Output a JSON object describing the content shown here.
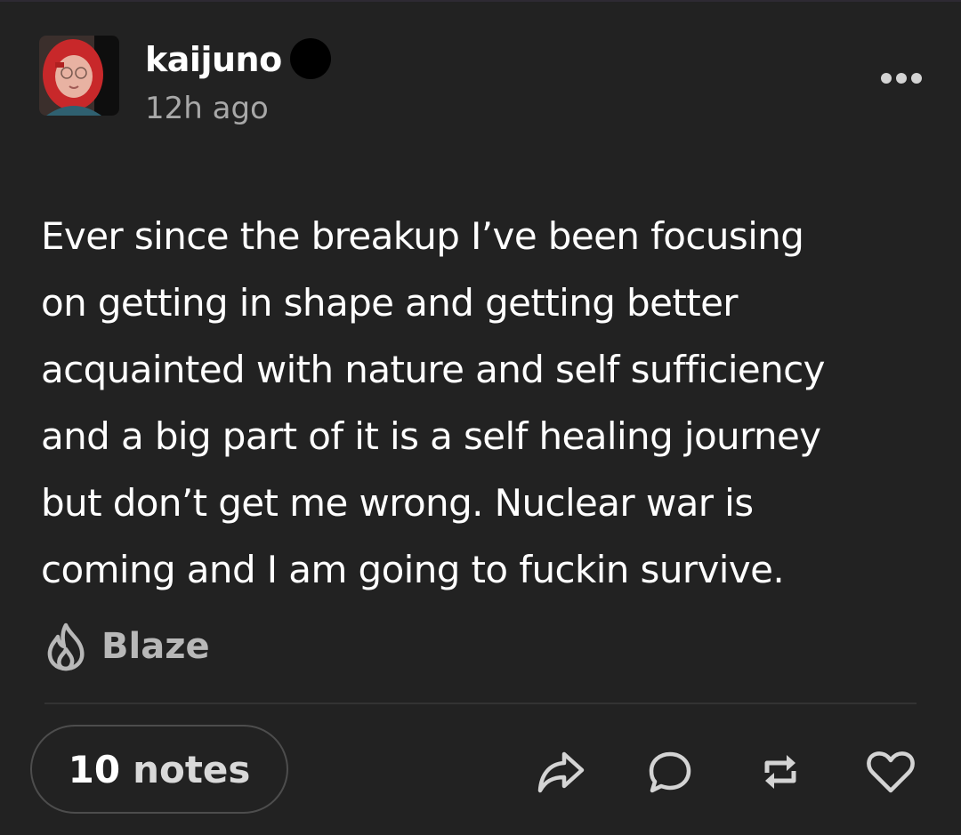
{
  "post": {
    "username": "kaijuno",
    "timestamp": "12h ago",
    "body_lines": [
      "Ever since the breakup I’ve been focusing",
      "on getting in shape and getting better",
      "acquainted with nature and self sufficiency",
      "and a big part of it is a self healing journey",
      "but don’t get me wrong. Nuclear war is",
      "coming and I am going to fuckin survive."
    ],
    "blaze_label": "Blaze",
    "notes_count": "10",
    "notes_label": "notes"
  },
  "icons": {
    "more": "more-horizontal-icon",
    "blaze": "flame-icon",
    "share": "share-arrow-icon",
    "reply": "comment-bubble-icon",
    "reblog": "reblog-icon",
    "like": "heart-icon"
  },
  "colors": {
    "background": "#222222",
    "text": "#ffffff",
    "muted": "#a8a8a8",
    "icon": "#d4d4d4"
  }
}
